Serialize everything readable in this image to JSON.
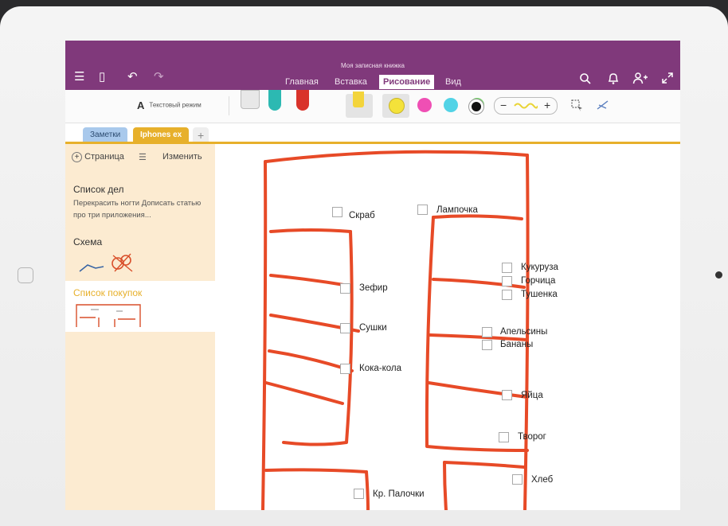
{
  "app": {
    "notebook_title": "Моя записная книжка",
    "tabs": [
      "Главная",
      "Вставка",
      "Рисование",
      "Вид"
    ],
    "active_tab": "Рисование"
  },
  "toolbar": {
    "text_mode_glyph": "A",
    "text_mode_label": "Текстовый режим",
    "thickness_minus": "−",
    "thickness_plus": "+",
    "pens": [
      {
        "name": "eraser-icon",
        "color": "#e8e8e8"
      },
      {
        "name": "pen-teal-icon",
        "color": "#2cb9b2"
      },
      {
        "name": "pen-red-icon",
        "color": "#d9332a"
      },
      {
        "name": "highlighter-yellow-icon",
        "color": "#f3d43b"
      }
    ],
    "colors": [
      "#f4e23a",
      "#ef4fb4",
      "#52d3e6",
      "#76d46a",
      "#111111"
    ],
    "selected_color": "#f4e23a"
  },
  "sections": [
    {
      "label": "Заметки",
      "color": "#a9c9ec"
    },
    {
      "label": "Iphones ex",
      "color": "#e7b02b"
    }
  ],
  "pagelist": {
    "add_page": "Страница",
    "edit": "Изменить",
    "pages": [
      {
        "title": "Список дел",
        "preview": "Перекрасить ногти  Дописать статью про три приложения..."
      },
      {
        "title": "Схема",
        "preview": ""
      },
      {
        "title": "Список покупок",
        "preview": ""
      }
    ]
  },
  "canvas": {
    "items": [
      "Скраб",
      "Лампочка",
      "Зефир",
      "Сушки",
      "Кока-кола",
      "Кукуруза",
      "Горчица",
      "Тушенка",
      "Апельсины",
      "Бананы",
      "Яйца",
      "Творог",
      "Хлеб",
      "Кр. Палочки"
    ],
    "ink_color": "#e74a27"
  },
  "theme": {
    "title_bar": "#80397b",
    "section_accent": "#e7b02b",
    "pagelist_bg": "#fcebd1"
  }
}
